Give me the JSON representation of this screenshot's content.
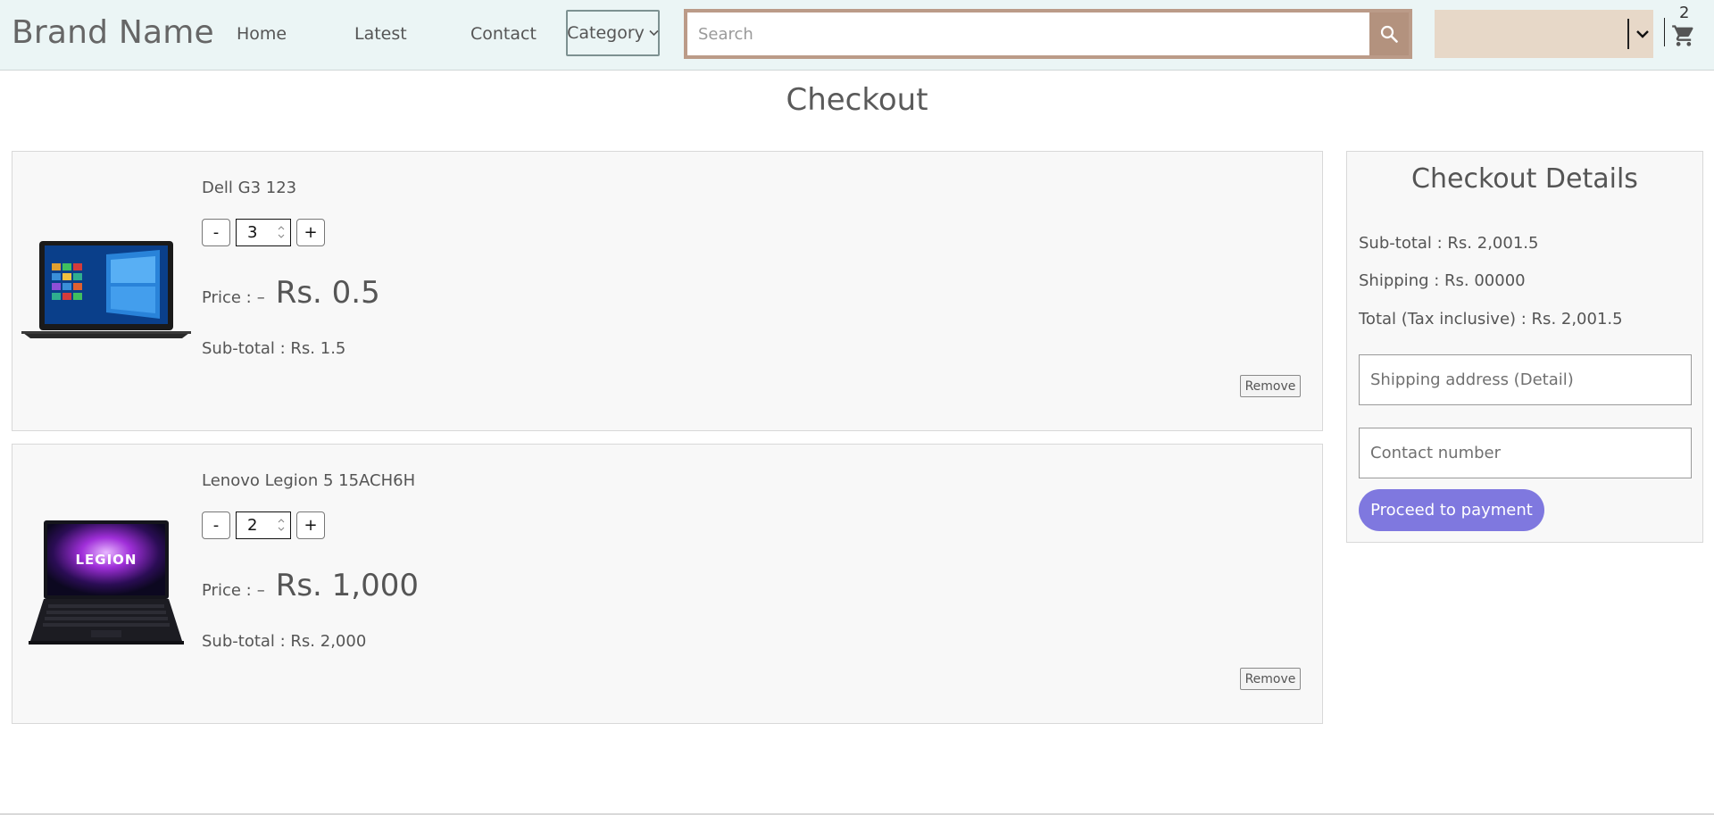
{
  "navbar": {
    "brand": "Brand Name",
    "links": [
      "Home",
      "Latest",
      "Contact"
    ],
    "category_label": "Category",
    "search_placeholder": "Search",
    "cart_count": "2"
  },
  "page": {
    "title": "Checkout"
  },
  "cart_items": [
    {
      "name": "Dell G3 123",
      "quantity": "3",
      "minus": "-",
      "plus": "+",
      "price_label": "Price :",
      "price_dash": "–",
      "price": "Rs. 0.5",
      "subtotal": "Sub-total : Rs. 1.5",
      "remove": "Remove"
    },
    {
      "name": "Lenovo Legion 5 15ACH6H",
      "quantity": "2",
      "minus": "-",
      "plus": "+",
      "price_label": "Price :",
      "price_dash": "–",
      "price": "Rs. 1,000",
      "subtotal": "Sub-total : Rs. 2,000",
      "remove": "Remove"
    }
  ],
  "checkout": {
    "title": "Checkout Details",
    "subtotal": "Sub-total : Rs. 2,001.5",
    "shipping": "Shipping : Rs. 00000",
    "total": "Total (Tax inclusive) : Rs. 2,001.5",
    "address_placeholder": "Shipping address (Detail)",
    "contact_placeholder": "Contact number",
    "proceed_label": "Proceed to payment"
  },
  "colors": {
    "navbar_bg": "#ebf5f5",
    "search_border": "#bb9b88",
    "search_button": "#b3927e",
    "user_select_bg": "#e7d8c8",
    "proceed_button": "#7f78df"
  },
  "icons": [
    "search-icon",
    "chevron-down-icon",
    "cart-icon",
    "laptop-image"
  ]
}
